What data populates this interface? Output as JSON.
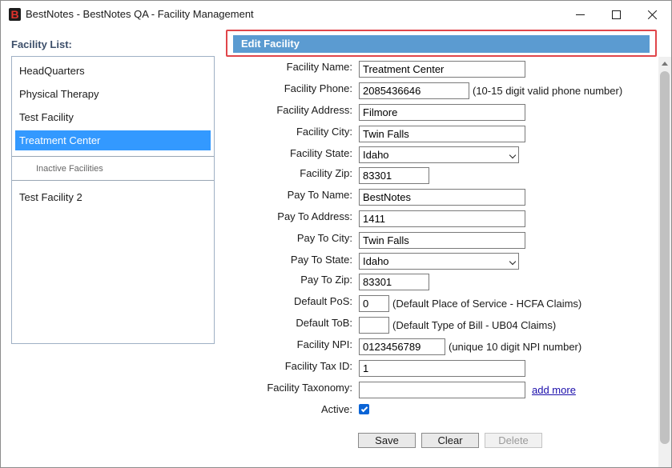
{
  "window": {
    "logo_letter": "B",
    "title": "BestNotes - BestNotes QA - Facility Management"
  },
  "sidebar": {
    "title": "Facility List:",
    "active_items": [
      {
        "label": "HeadQuarters",
        "selected": false
      },
      {
        "label": "Physical Therapy",
        "selected": false
      },
      {
        "label": "Test Facility",
        "selected": false
      },
      {
        "label": "Treatment Center",
        "selected": true
      }
    ],
    "inactive_title": "Inactive Facilities",
    "inactive_items": [
      {
        "label": "Test Facility 2"
      }
    ]
  },
  "form": {
    "header": "Edit Facility",
    "facility_name": {
      "label": "Facility Name:",
      "value": "Treatment Center"
    },
    "facility_phone": {
      "label": "Facility Phone:",
      "value": "2085436646",
      "hint": "(10-15 digit valid phone number)"
    },
    "facility_address": {
      "label": "Facility Address:",
      "value": "Filmore"
    },
    "facility_city": {
      "label": "Facility City:",
      "value": "Twin Falls"
    },
    "facility_state": {
      "label": "Facility State:",
      "value": "Idaho"
    },
    "facility_zip": {
      "label": "Facility Zip:",
      "value": "83301"
    },
    "pay_to_name": {
      "label": "Pay To Name:",
      "value": "BestNotes"
    },
    "pay_to_address": {
      "label": "Pay To Address:",
      "value": "1411"
    },
    "pay_to_city": {
      "label": "Pay To City:",
      "value": "Twin Falls"
    },
    "pay_to_state": {
      "label": "Pay To State:",
      "value": "Idaho"
    },
    "pay_to_zip": {
      "label": "Pay To Zip:",
      "value": "83301"
    },
    "default_pos": {
      "label": "Default PoS:",
      "value": "0",
      "hint": "(Default Place of Service - HCFA Claims)"
    },
    "default_tob": {
      "label": "Default ToB:",
      "value": "",
      "hint": "(Default Type of Bill - UB04 Claims)"
    },
    "facility_npi": {
      "label": "Facility NPI:",
      "value": "0123456789",
      "hint": "(unique 10 digit NPI number)"
    },
    "facility_tax_id": {
      "label": "Facility Tax ID:",
      "value": "1"
    },
    "facility_taxonomy": {
      "label": "Facility Taxonomy:",
      "value": "",
      "link": "add more"
    },
    "active": {
      "label": "Active:",
      "checked": true
    }
  },
  "buttons": {
    "save": "Save",
    "clear": "Clear",
    "delete": "Delete"
  }
}
